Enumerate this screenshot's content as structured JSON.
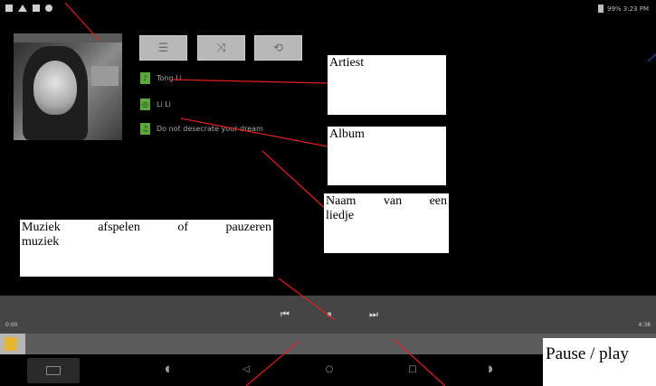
{
  "status_bar": {
    "left_icons": [
      "notification-icon",
      "warning-icon",
      "download-icon",
      "location-icon"
    ],
    "right_text": "99% 3:23 PM"
  },
  "track": {
    "artist": "Tong Li",
    "album": "Li Li",
    "song": "Do not desecrate your dream"
  },
  "controls": [
    "playlist-icon",
    "shuffle-icon",
    "repeat-icon"
  ],
  "player": {
    "elapsed": "0:00",
    "total": "4:38",
    "progress_fraction": 0.02
  },
  "nav": [
    "screenshot-icon",
    "volume-down-icon",
    "back-icon",
    "home-icon",
    "recent-apps-icon",
    "volume-up-icon"
  ],
  "annotations": {
    "artist": "Artiest",
    "album": "Album",
    "song_words": [
      "Naam",
      "van",
      "een"
    ],
    "song_last": "liedje",
    "play_pause_words": [
      "Muziek",
      "afspelen",
      "of",
      "pauzeren"
    ],
    "play_pause_last": "muziek",
    "pause_play": "Pause / play"
  },
  "colors": {
    "annotation_line": "#e02020",
    "accent_green": "#5da83a",
    "thumb": "#e3b530"
  }
}
